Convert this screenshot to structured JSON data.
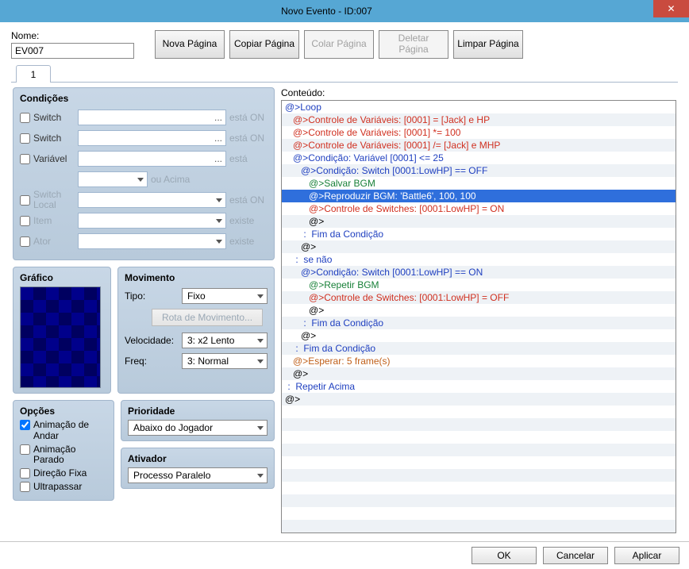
{
  "title": "Novo Evento - ID:007",
  "close_glyph": "✕",
  "nome_label": "Nome:",
  "nome_value": "EV007",
  "toolbar": {
    "nova": "Nova\nPágina",
    "copiar": "Copiar\nPágina",
    "colar": "Colar\nPágina",
    "deletar": "Deletar\nPágina",
    "limpar": "Limpar\nPágina"
  },
  "tab_label": "1",
  "condicoes": {
    "title": "Condições",
    "switch1": "Switch",
    "switch1_post": "está ON",
    "switch2": "Switch",
    "switch2_post": "está ON",
    "variavel": "Variável",
    "variavel_post": "está",
    "ouacima": "ou Acima",
    "switchlocal": "Switch Local",
    "switchlocal_post": "está ON",
    "item": "Item",
    "item_post": "existe",
    "ator": "Ator",
    "ator_post": "existe",
    "dots": "..."
  },
  "grafico_title": "Gráfico",
  "movimento": {
    "title": "Movimento",
    "tipo_label": "Tipo:",
    "tipo_value": "Fixo",
    "rota": "Rota de Movimento...",
    "vel_label": "Velocidade:",
    "vel_value": "3: x2 Lento",
    "freq_label": "Freq:",
    "freq_value": "3: Normal"
  },
  "opcoes": {
    "title": "Opções",
    "andar": "Animação de Andar",
    "parado": "Animação Parado",
    "dir": "Direção Fixa",
    "ultra": "Ultrapassar"
  },
  "prioridade": {
    "title": "Prioridade",
    "value": "Abaixo do Jogador"
  },
  "ativador": {
    "title": "Ativador",
    "value": "Processo Paralelo"
  },
  "conteudo_label": "Conteúdo:",
  "code": [
    {
      "i": 0,
      "c": "blue",
      "t": "@>Loop"
    },
    {
      "i": 1,
      "c": "red",
      "t": "@>Controle de Variáveis: [0001] = [Jack] e HP"
    },
    {
      "i": 1,
      "c": "red",
      "t": "@>Controle de Variáveis: [0001] *= 100"
    },
    {
      "i": 1,
      "c": "red",
      "t": "@>Controle de Variáveis: [0001] /= [Jack] e MHP"
    },
    {
      "i": 1,
      "c": "blue",
      "t": "@>Condição: Variável [0001] <= 25"
    },
    {
      "i": 2,
      "c": "blue",
      "t": "@>Condição: Switch [0001:LowHP] == OFF"
    },
    {
      "i": 3,
      "c": "green",
      "t": "@>Salvar BGM"
    },
    {
      "i": 3,
      "c": "green",
      "t": "@>Reproduzir BGM: 'Battle6', 100, 100",
      "sel": true
    },
    {
      "i": 3,
      "c": "red",
      "t": "@>Controle de Switches: [0001:LowHP] = ON"
    },
    {
      "i": 3,
      "c": "black",
      "t": "@>"
    },
    {
      "i": 2,
      "c": "blue",
      "t": " :  Fim da Condição"
    },
    {
      "i": 2,
      "c": "black",
      "t": "@>"
    },
    {
      "i": 1,
      "c": "blue",
      "t": " :  se não"
    },
    {
      "i": 2,
      "c": "blue",
      "t": "@>Condição: Switch [0001:LowHP] == ON"
    },
    {
      "i": 3,
      "c": "green",
      "t": "@>Repetir BGM"
    },
    {
      "i": 3,
      "c": "red",
      "t": "@>Controle de Switches: [0001:LowHP] = OFF"
    },
    {
      "i": 3,
      "c": "black",
      "t": "@>"
    },
    {
      "i": 2,
      "c": "blue",
      "t": " :  Fim da Condição"
    },
    {
      "i": 2,
      "c": "black",
      "t": "@>"
    },
    {
      "i": 1,
      "c": "blue",
      "t": " :  Fim da Condição"
    },
    {
      "i": 1,
      "c": "orange",
      "t": "@>Esperar: 5 frame(s)"
    },
    {
      "i": 1,
      "c": "black",
      "t": "@>"
    },
    {
      "i": 0,
      "c": "blue",
      "t": " :  Repetir Acima"
    },
    {
      "i": 0,
      "c": "black",
      "t": "@>"
    }
  ],
  "buttons": {
    "ok": "OK",
    "cancel": "Cancelar",
    "apply": "Aplicar"
  }
}
